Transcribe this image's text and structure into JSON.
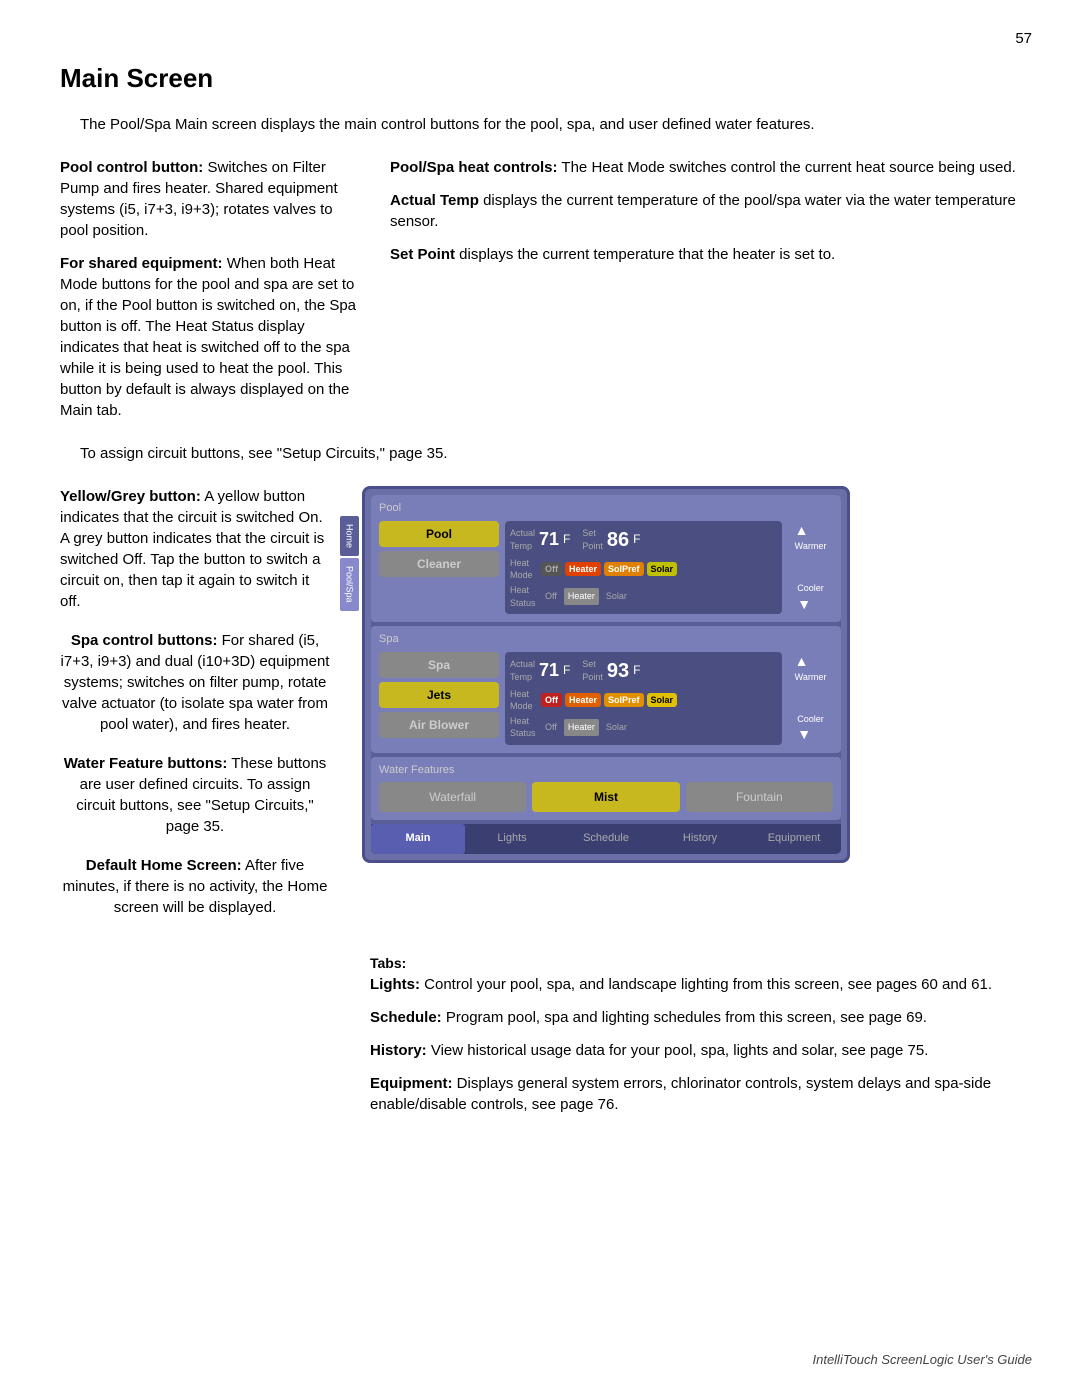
{
  "page": {
    "number": "57",
    "title": "Main Screen",
    "intro": "The Pool/Spa Main screen displays the main control buttons for the pool, spa, and user defined water features.",
    "footer": "IntelliTouch ScreenLogic User's Guide"
  },
  "left_paragraphs": [
    {
      "bold": "Pool control button:",
      "text": " Switches on Filter Pump and fires heater. Shared equipment systems (i5, i7+3, i9+3); rotates valves to pool position."
    },
    {
      "bold": "For shared equipment:",
      "text": " When both Heat Mode buttons for the pool and spa are set to on, if the Pool button is switched on, the Spa button is off. The Heat Status display indicates that heat is switched off to the spa while it is being used to heat the pool. This button by default is always displayed on the Main tab."
    }
  ],
  "assign_note": "To assign circuit buttons, see \"Setup Circuits,\" page 35.",
  "right_paragraphs": [
    {
      "bold": "Pool/Spa heat controls:",
      "text": " The Heat Mode switches control the current heat source being used."
    },
    {
      "bold": "Actual Temp",
      "text": " displays the current temperature of the pool/spa water via the water temperature sensor."
    },
    {
      "bold": "Set Point",
      "text": " displays the current temperature that the heater is set to."
    }
  ],
  "left_annotations": [
    {
      "id": "yellow-grey",
      "bold": "Yellow/Grey button:",
      "text": " A yellow button indicates that the circuit is switched On. A grey button indicates that the circuit is switched Off. Tap the button to switch a circuit on, then tap it again to switch it off."
    },
    {
      "id": "spa-control",
      "bold": "Spa control buttons:",
      "text": " For shared (i5, i7+3, i9+3) and dual (i10+3D) equipment systems; switches on filter pump, rotate valve actuator (to isolate spa water from pool water), and fires heater."
    },
    {
      "id": "water-feature",
      "bold": "Water Feature buttons:",
      "text": " These buttons are user defined circuits. To assign circuit buttons, see \"Setup Circuits,\" page 35."
    },
    {
      "id": "default-home",
      "bold": "Default Home Screen:",
      "text": " After five minutes, if there is no activity, the Home screen will be displayed."
    }
  ],
  "screen": {
    "pool": {
      "label": "Pool",
      "buttons": [
        {
          "label": "Pool",
          "active": true
        },
        {
          "label": "Cleaner",
          "active": false
        }
      ],
      "actual_temp_label": "Actual\nTemp",
      "actual_temp_value": "71",
      "actual_temp_unit": "F",
      "set_point_label": "Set\nPoint",
      "set_point_value": "86",
      "set_point_unit": "F",
      "heat_mode_label": "Heat\nMode",
      "heat_mode_buttons": [
        "Off",
        "Heater",
        "SolPref",
        "Solar"
      ],
      "heat_mode_active": 1,
      "heat_status_label": "Heat\nStatus",
      "heat_status_values": [
        "Off",
        "Heater",
        "Solar"
      ],
      "heat_status_active": 1,
      "warmer_label": "Warmer",
      "cooler_label": "Cooler"
    },
    "spa": {
      "label": "Spa",
      "buttons": [
        {
          "label": "Spa",
          "active": false
        },
        {
          "label": "Jets",
          "active": true
        },
        {
          "label": "Air Blower",
          "active": false
        }
      ],
      "actual_temp_label": "Actual\nTemp",
      "actual_temp_value": "71",
      "actual_temp_unit": "F",
      "set_point_label": "Set\nPoint",
      "set_point_value": "93",
      "set_point_unit": "F",
      "heat_mode_label": "Heat\nMode",
      "heat_mode_buttons": [
        "Off",
        "Heater",
        "SolPref",
        "Solar"
      ],
      "heat_mode_active": 0,
      "heat_status_label": "Heat\nStatus",
      "heat_status_values": [
        "Off",
        "Heater",
        "Solar"
      ],
      "heat_status_active": 1,
      "warmer_label": "Warmer",
      "cooler_label": "Cooler"
    },
    "water_features": {
      "label": "Water Features",
      "buttons": [
        {
          "label": "Waterfall",
          "active": false
        },
        {
          "label": "Mist",
          "active": true
        },
        {
          "label": "Fountain",
          "active": false
        }
      ]
    },
    "tabs": [
      {
        "label": "Main",
        "active": true
      },
      {
        "label": "Lights",
        "active": false
      },
      {
        "label": "Schedule",
        "active": false
      },
      {
        "label": "History",
        "active": false
      },
      {
        "label": "Equipment",
        "active": false
      }
    ],
    "side_nav": [
      {
        "label": "Home",
        "active": false
      },
      {
        "label": "Pool/Spa",
        "active": true
      }
    ]
  },
  "below_left": [
    {
      "bold": "Default Home Screen:",
      "text": " After five minutes, if there is no activity, the Home screen will be displayed."
    }
  ],
  "tabs_section": {
    "header": "Tabs:",
    "items": [
      {
        "bold": "Lights:",
        "text": " Control your pool, spa, and landscape lighting from this screen, see pages 60 and 61."
      },
      {
        "bold": "Schedule:",
        "text": " Program pool, spa and lighting schedules from this screen, see page 69."
      },
      {
        "bold": "History:",
        "text": " View historical usage data for your pool, spa, lights and solar, see page 75."
      },
      {
        "bold": "Equipment:",
        "text": " Displays general system errors, chlorinator controls, system delays and spa-side enable/disable controls, see page 76."
      }
    ]
  }
}
